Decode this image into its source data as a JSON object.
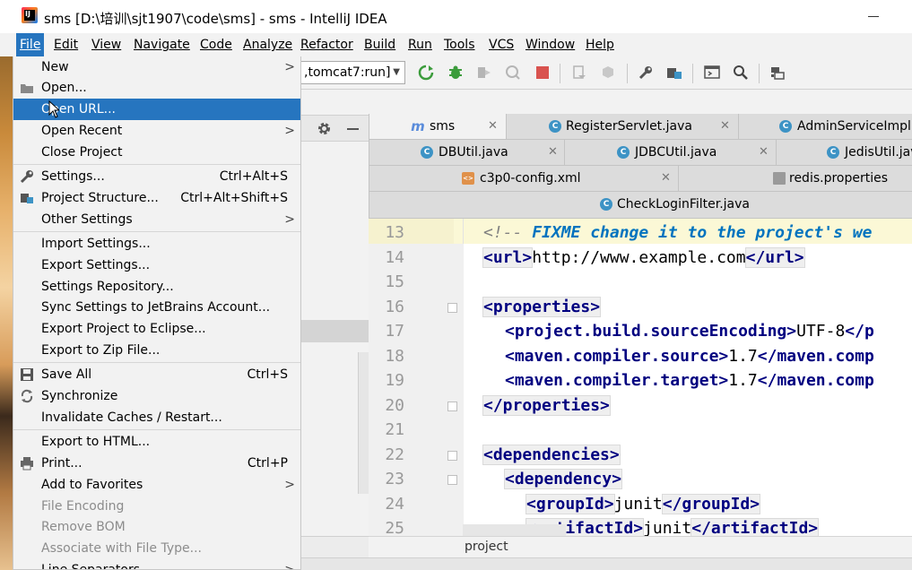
{
  "window": {
    "title": "sms [D:\\培训\\sjt1907\\code\\sms] - sms - IntelliJ IDEA",
    "app_icon_text": "IJ"
  },
  "menubar": {
    "items": [
      "File",
      "Edit",
      "View",
      "Navigate",
      "Code",
      "Analyze",
      "Refactor",
      "Build",
      "Run",
      "Tools",
      "VCS",
      "Window",
      "Help"
    ],
    "active": "File"
  },
  "toolbar": {
    "run_config": ",tomcat7:run]",
    "icons": [
      "build-icon",
      "debug-icon",
      "coverage-icon",
      "profile-icon",
      "stop-icon",
      "deploy-icon",
      "attach-icon",
      "settings-wrench-icon",
      "project-structure-icon",
      "terminal-icon",
      "search-icon",
      "sdk-icon"
    ]
  },
  "file_menu": {
    "items": [
      {
        "label": "New",
        "submenu": true
      },
      {
        "label": "Open...",
        "icon": "folder-icon"
      },
      {
        "label": "Open URL...",
        "highlight": true
      },
      {
        "label": "Open Recent",
        "submenu": true
      },
      {
        "label": "Close Project"
      },
      {
        "label": "Settings...",
        "shortcut": "Ctrl+Alt+S",
        "icon": "wrench-icon"
      },
      {
        "label": "Project Structure...",
        "shortcut": "Ctrl+Alt+Shift+S",
        "icon": "project-structure-icon"
      },
      {
        "label": "Other Settings",
        "submenu": true
      },
      {
        "label": "Import Settings..."
      },
      {
        "label": "Export Settings..."
      },
      {
        "label": "Settings Repository..."
      },
      {
        "label": "Sync Settings to JetBrains Account..."
      },
      {
        "label": "Export Project to Eclipse..."
      },
      {
        "label": "Export to Zip File..."
      },
      {
        "label": "Save All",
        "shortcut": "Ctrl+S",
        "icon": "save-icon"
      },
      {
        "label": "Synchronize",
        "icon": "sync-icon"
      },
      {
        "label": "Invalidate Caches / Restart..."
      },
      {
        "label": "Export to HTML..."
      },
      {
        "label": "Print...",
        "shortcut": "Ctrl+P",
        "icon": "print-icon"
      },
      {
        "label": "Add to Favorites",
        "submenu": true
      },
      {
        "label": "File Encoding",
        "disabled": true
      },
      {
        "label": "Remove BOM",
        "disabled": true
      },
      {
        "label": "Associate with File Type...",
        "disabled": true
      },
      {
        "label": "Line Separators",
        "submenu": true
      }
    ]
  },
  "tabs": {
    "row1": [
      "sms",
      "RegisterServlet.java",
      "AdminServiceImpl.ja"
    ],
    "row2": [
      "DBUtil.java",
      "JDBCUtil.java",
      "JedisUtil.jav"
    ],
    "row3": [
      "c3p0-config.xml",
      "redis.properties"
    ],
    "row4": [
      "CheckLoginFilter.java"
    ],
    "selected": "sms"
  },
  "editor": {
    "line_numbers": [
      "13",
      "14",
      "15",
      "16",
      "17",
      "18",
      "19",
      "20",
      "21",
      "22",
      "23",
      "24",
      "25"
    ],
    "lines": {
      "l13_open": "<!-- ",
      "l13_todo": "FIXME change it to the project's we",
      "l14_open": "<url>",
      "l14_text": "http://www.example.com",
      "l14_close": "</url>",
      "l16": "<properties>",
      "l17_open": "<project.build.sourceEncoding>",
      "l17_text": "UTF-8",
      "l17_close": "</p",
      "l18_open": "<maven.compiler.source>",
      "l18_text": "1.7",
      "l18_close": "</maven.comp",
      "l19_open": "<maven.compiler.target>",
      "l19_text": "1.7",
      "l19_close": "</maven.comp",
      "l20": "</properties>",
      "l22": "<dependencies>",
      "l23": "<dependency>",
      "l24_open": "<groupId>",
      "l24_text": "junit",
      "l24_close": "</groupId>",
      "l25_open": "<artifactId>",
      "l25_text": "junit",
      "l25_close": "</artifactId>"
    },
    "breadcrumb": "project"
  },
  "colors": {
    "menu_highlight": "#2675bf",
    "xml_tag": "#000080",
    "comment": "#808080",
    "todo": "#0073bf"
  }
}
